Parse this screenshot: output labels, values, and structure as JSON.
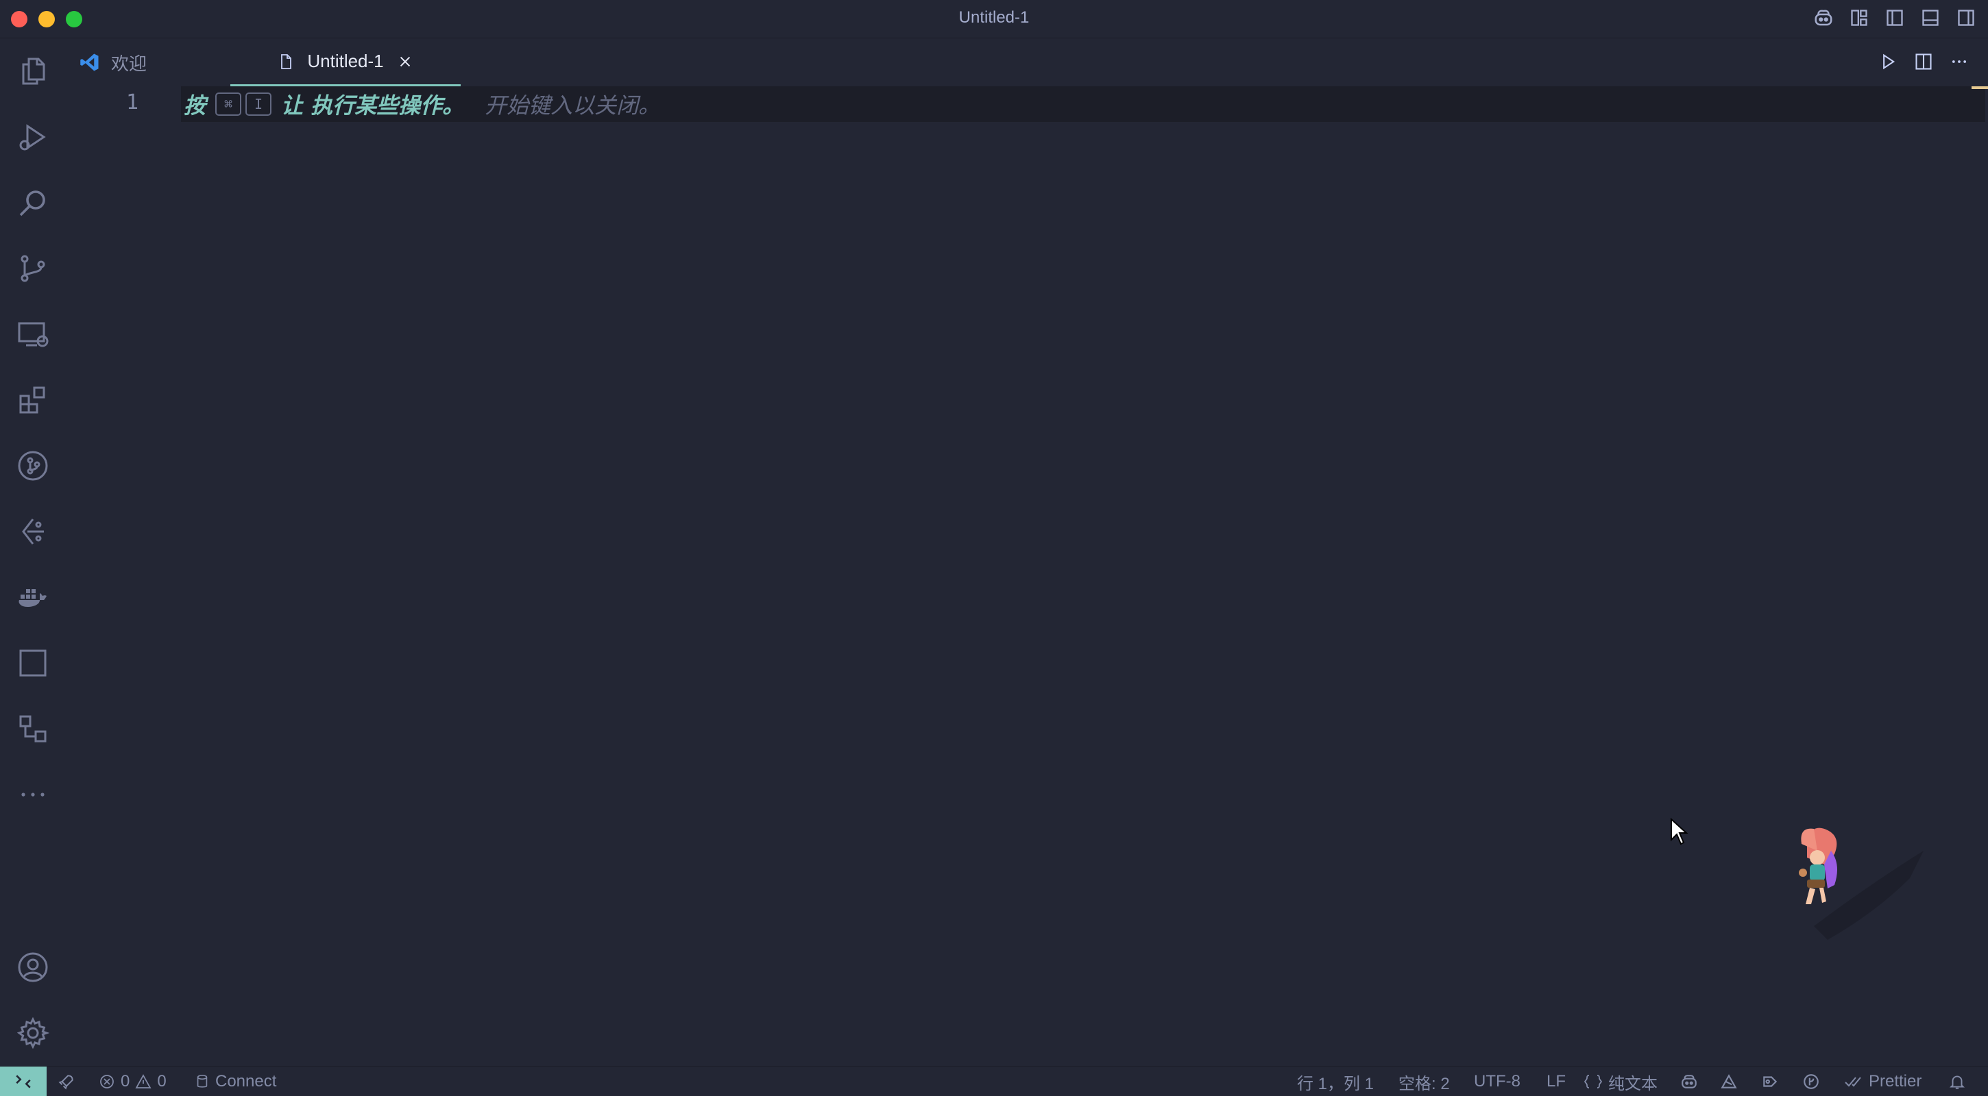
{
  "window": {
    "title": "Untitled-1"
  },
  "tabs": [
    {
      "label": "欢迎",
      "icon": "vscode-logo-icon",
      "active": false
    },
    {
      "label": "Untitled-1",
      "icon": "file-icon",
      "active": true
    }
  ],
  "editor": {
    "line_number": "1",
    "hint": {
      "press": "按",
      "key1": "⌘",
      "key2": "I",
      "action": "让 执行某些操作。",
      "dismiss": "开始键入以关闭。"
    }
  },
  "activity_bar": [
    "explorer-icon",
    "run-debug-icon",
    "search-icon",
    "source-control-icon",
    "remote-explorer-icon",
    "extensions-icon",
    "git-graph-icon",
    "gitlens-icon",
    "docker-icon",
    "square-icon",
    "flow-icon",
    "more-icon",
    "account-icon",
    "settings-gear-icon"
  ],
  "status_bar": {
    "errors": "0",
    "warnings": "0",
    "connect": "Connect",
    "position": "行 1，列 1",
    "spaces": "空格: 2",
    "encoding": "UTF-8",
    "eol": "LF",
    "language": "纯文本",
    "formatter": "Prettier"
  },
  "colors": {
    "background": "#232634",
    "accent": "#81c8be",
    "current_line": "#1c1e28"
  }
}
